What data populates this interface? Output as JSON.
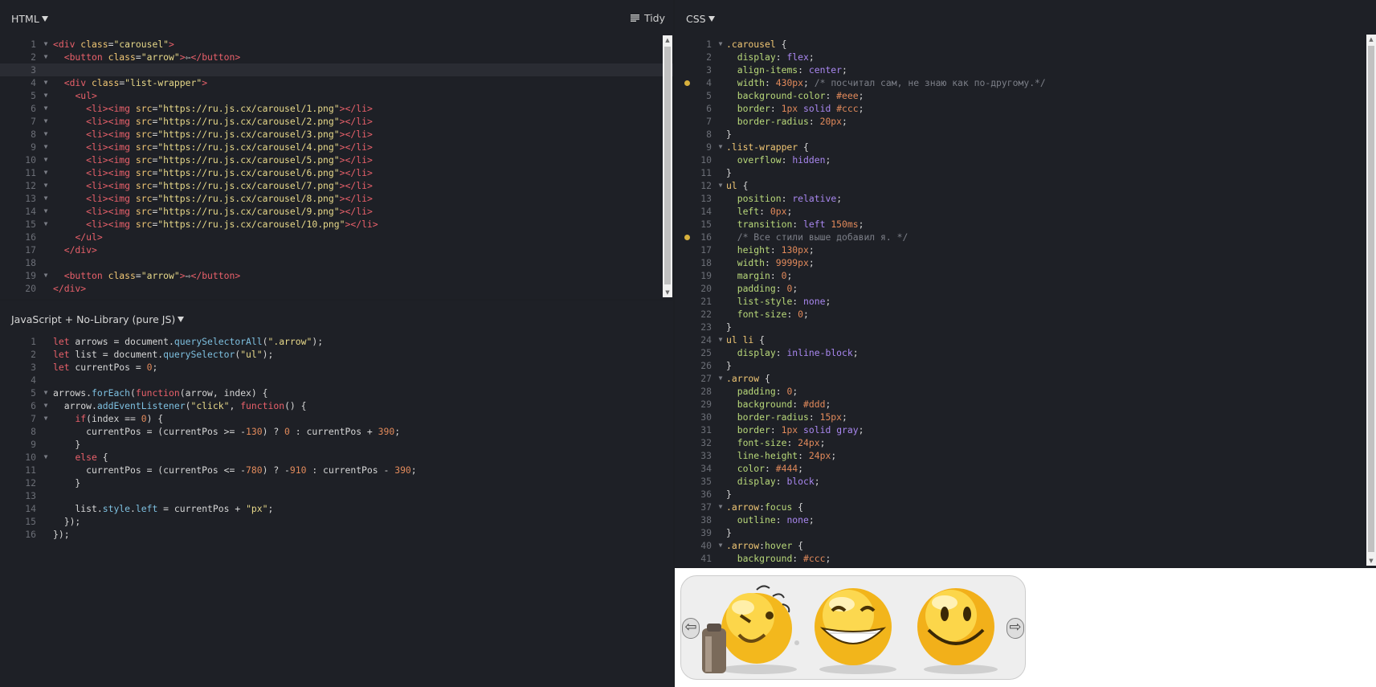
{
  "html_panel": {
    "title": "HTML",
    "tidy_label": "Tidy",
    "lines": [
      {
        "n": "1",
        "f": true,
        "c": "<div class=\"carousel\">"
      },
      {
        "n": "2",
        "f": true,
        "c": "  <button class=\"arrow\">⇦</button>"
      },
      {
        "n": "3",
        "f": false,
        "c": ""
      },
      {
        "n": "4",
        "f": true,
        "c": "  <div class=\"list-wrapper\">"
      },
      {
        "n": "5",
        "f": true,
        "c": "    <ul>"
      },
      {
        "n": "6",
        "f": true,
        "c": "      <li><img src=\"https://ru.js.cx/carousel/1.png\"></li>"
      },
      {
        "n": "7",
        "f": true,
        "c": "      <li><img src=\"https://ru.js.cx/carousel/2.png\"></li>"
      },
      {
        "n": "8",
        "f": true,
        "c": "      <li><img src=\"https://ru.js.cx/carousel/3.png\"></li>"
      },
      {
        "n": "9",
        "f": true,
        "c": "      <li><img src=\"https://ru.js.cx/carousel/4.png\"></li>"
      },
      {
        "n": "10",
        "f": true,
        "c": "      <li><img src=\"https://ru.js.cx/carousel/5.png\"></li>"
      },
      {
        "n": "11",
        "f": true,
        "c": "      <li><img src=\"https://ru.js.cx/carousel/6.png\"></li>"
      },
      {
        "n": "12",
        "f": true,
        "c": "      <li><img src=\"https://ru.js.cx/carousel/7.png\"></li>"
      },
      {
        "n": "13",
        "f": true,
        "c": "      <li><img src=\"https://ru.js.cx/carousel/8.png\"></li>"
      },
      {
        "n": "14",
        "f": true,
        "c": "      <li><img src=\"https://ru.js.cx/carousel/9.png\"></li>"
      },
      {
        "n": "15",
        "f": true,
        "c": "      <li><img src=\"https://ru.js.cx/carousel/10.png\"></li>"
      },
      {
        "n": "16",
        "f": false,
        "c": "    </ul>"
      },
      {
        "n": "17",
        "f": false,
        "c": "  </div>"
      },
      {
        "n": "18",
        "f": false,
        "c": ""
      },
      {
        "n": "19",
        "f": true,
        "c": "  <button class=\"arrow\">⇨</button>"
      },
      {
        "n": "20",
        "f": false,
        "c": "</div>"
      }
    ]
  },
  "js_panel": {
    "title": "JavaScript + No-Library (pure JS)",
    "lines": [
      {
        "n": "1",
        "f": false,
        "c": "let arrows = document.querySelectorAll(\".arrow\");"
      },
      {
        "n": "2",
        "f": false,
        "c": "let list = document.querySelector(\"ul\");"
      },
      {
        "n": "3",
        "f": false,
        "c": "let currentPos = 0;"
      },
      {
        "n": "4",
        "f": false,
        "c": ""
      },
      {
        "n": "5",
        "f": true,
        "c": "arrows.forEach(function(arrow, index) {"
      },
      {
        "n": "6",
        "f": true,
        "c": "  arrow.addEventListener(\"click\", function() {"
      },
      {
        "n": "7",
        "f": true,
        "c": "    if(index == 0) {"
      },
      {
        "n": "8",
        "f": false,
        "c": "      currentPos = (currentPos >= -130) ? 0 : currentPos + 390;"
      },
      {
        "n": "9",
        "f": false,
        "c": "    }"
      },
      {
        "n": "10",
        "f": true,
        "c": "    else {"
      },
      {
        "n": "11",
        "f": false,
        "c": "      currentPos = (currentPos <= -780) ? -910 : currentPos - 390;"
      },
      {
        "n": "12",
        "f": false,
        "c": "    }"
      },
      {
        "n": "13",
        "f": false,
        "c": ""
      },
      {
        "n": "14",
        "f": false,
        "c": "    list.style.left = currentPos + \"px\";"
      },
      {
        "n": "15",
        "f": false,
        "c": "  });"
      },
      {
        "n": "16",
        "f": false,
        "c": "});"
      }
    ]
  },
  "css_panel": {
    "title": "CSS",
    "lines": [
      {
        "n": "1",
        "f": true,
        "c": ".carousel {"
      },
      {
        "n": "2",
        "f": false,
        "c": "  display: flex;"
      },
      {
        "n": "3",
        "f": false,
        "c": "  align-items: center;"
      },
      {
        "n": "4",
        "f": false,
        "c": "  width: 430px; /* посчитал сам, не знаю как по-другому.*/",
        "w": true
      },
      {
        "n": "5",
        "f": false,
        "c": "  background-color: #eee;"
      },
      {
        "n": "6",
        "f": false,
        "c": "  border: 1px solid #ccc;"
      },
      {
        "n": "7",
        "f": false,
        "c": "  border-radius: 20px;"
      },
      {
        "n": "8",
        "f": false,
        "c": "}"
      },
      {
        "n": "9",
        "f": true,
        "c": ".list-wrapper {"
      },
      {
        "n": "10",
        "f": false,
        "c": "  overflow: hidden;"
      },
      {
        "n": "11",
        "f": false,
        "c": "}"
      },
      {
        "n": "12",
        "f": true,
        "c": "ul {"
      },
      {
        "n": "13",
        "f": false,
        "c": "  position: relative;"
      },
      {
        "n": "14",
        "f": false,
        "c": "  left: 0px;"
      },
      {
        "n": "15",
        "f": false,
        "c": "  transition: left 150ms;"
      },
      {
        "n": "16",
        "f": false,
        "c": "  /* Все стили выше добавил я. */",
        "w": true
      },
      {
        "n": "17",
        "f": false,
        "c": "  height: 130px;"
      },
      {
        "n": "18",
        "f": false,
        "c": "  width: 9999px;"
      },
      {
        "n": "19",
        "f": false,
        "c": "  margin: 0;"
      },
      {
        "n": "20",
        "f": false,
        "c": "  padding: 0;"
      },
      {
        "n": "21",
        "f": false,
        "c": "  list-style: none;"
      },
      {
        "n": "22",
        "f": false,
        "c": "  font-size: 0;"
      },
      {
        "n": "23",
        "f": false,
        "c": "}"
      },
      {
        "n": "24",
        "f": true,
        "c": "ul li {"
      },
      {
        "n": "25",
        "f": false,
        "c": "  display: inline-block;"
      },
      {
        "n": "26",
        "f": false,
        "c": "}"
      },
      {
        "n": "27",
        "f": true,
        "c": ".arrow {"
      },
      {
        "n": "28",
        "f": false,
        "c": "  padding: 0;"
      },
      {
        "n": "29",
        "f": false,
        "c": "  background: #ddd;"
      },
      {
        "n": "30",
        "f": false,
        "c": "  border-radius: 15px;"
      },
      {
        "n": "31",
        "f": false,
        "c": "  border: 1px solid gray;"
      },
      {
        "n": "32",
        "f": false,
        "c": "  font-size: 24px;"
      },
      {
        "n": "33",
        "f": false,
        "c": "  line-height: 24px;"
      },
      {
        "n": "34",
        "f": false,
        "c": "  color: #444;"
      },
      {
        "n": "35",
        "f": false,
        "c": "  display: block;"
      },
      {
        "n": "36",
        "f": false,
        "c": "}"
      },
      {
        "n": "37",
        "f": true,
        "c": ".arrow:focus {"
      },
      {
        "n": "38",
        "f": false,
        "c": "  outline: none;"
      },
      {
        "n": "39",
        "f": false,
        "c": "}"
      },
      {
        "n": "40",
        "f": true,
        "c": ".arrow:hover {"
      },
      {
        "n": "41",
        "f": false,
        "c": "  background: #ccc;"
      }
    ]
  },
  "result": {
    "left_arrow": "⇦",
    "right_arrow": "⇨"
  },
  "colors": {
    "editor_bg": "#1e2026",
    "tag": "#e8606a",
    "string": "#e8d98a",
    "number": "#e28a5b",
    "property": "#b9d97a",
    "value": "#a987f0",
    "warning_dot": "#d8b13d"
  }
}
